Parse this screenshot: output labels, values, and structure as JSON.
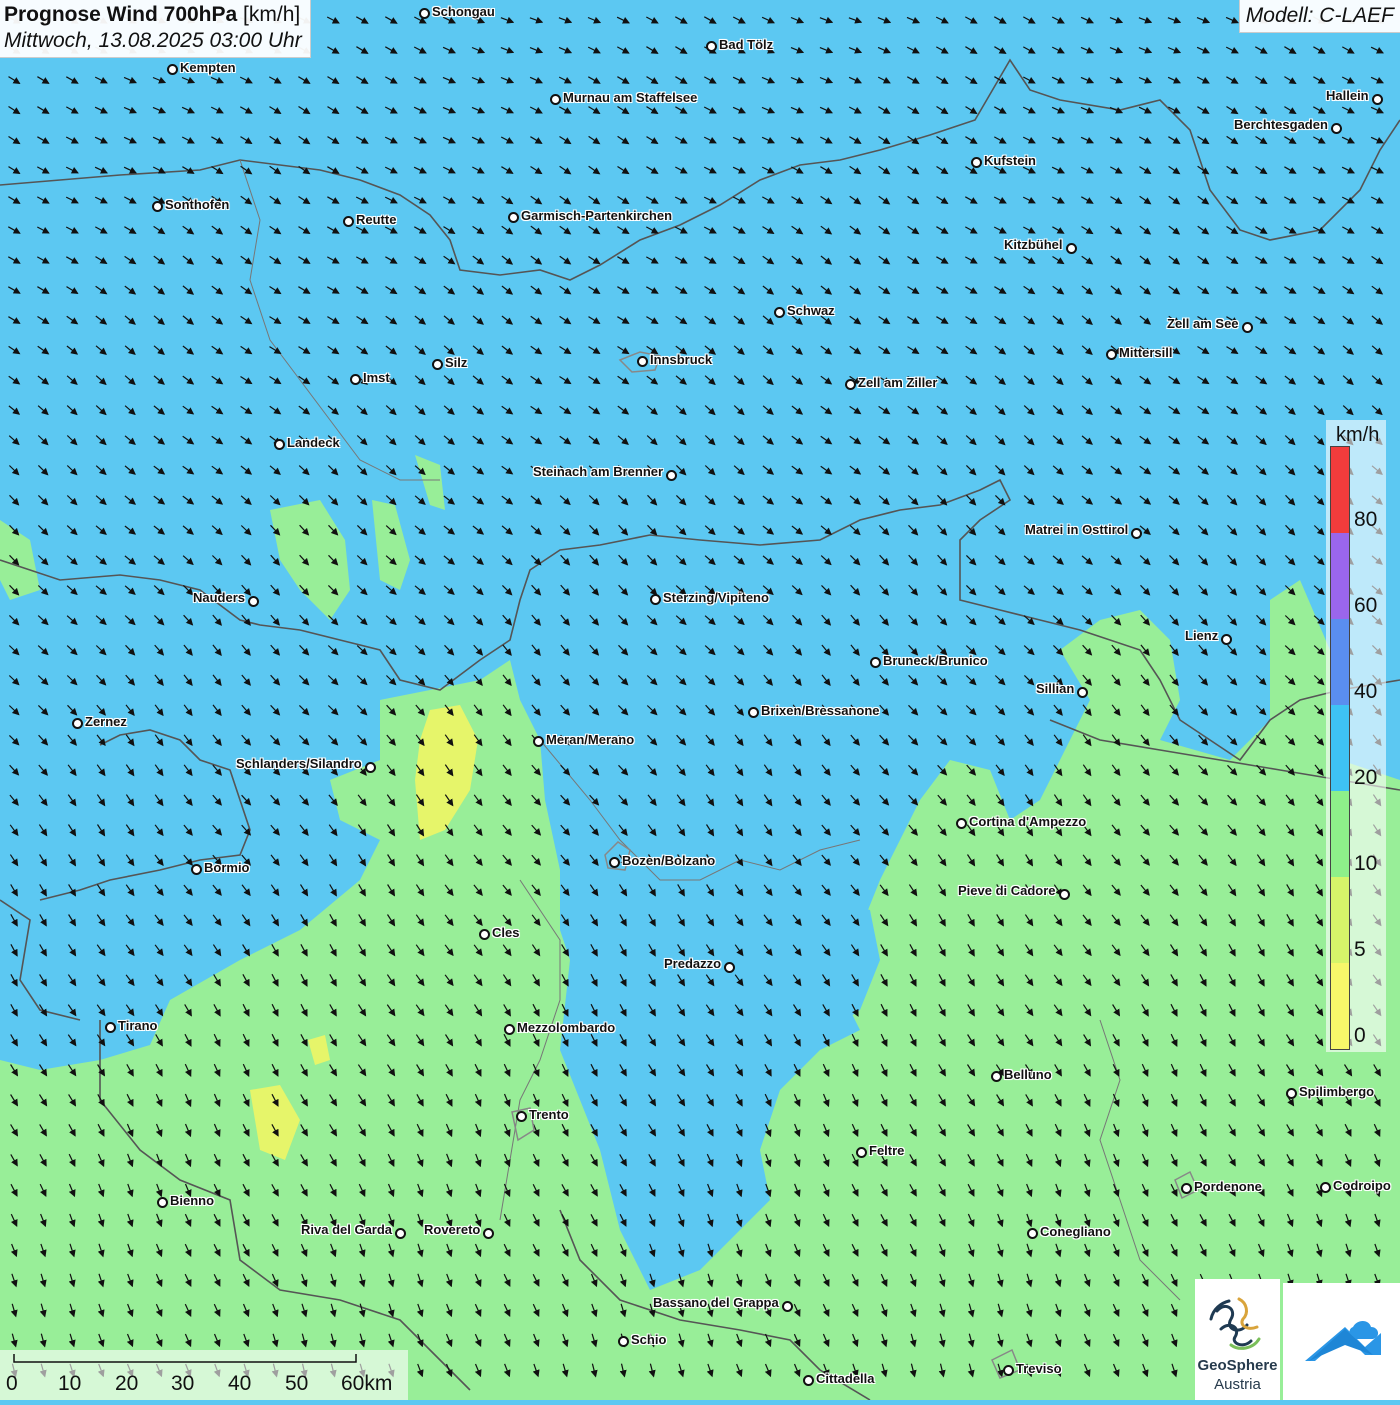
{
  "title": {
    "main_bold": "Prognose Wind 700hPa",
    "main_unit": "[km/h]",
    "subtitle": "Mittwoch, 13.08.2025 03:00 Uhr"
  },
  "model": "Modell: C-LAEF",
  "legend": {
    "unit": "km/h",
    "ticks": [
      "80",
      "60",
      "40",
      "20",
      "10",
      "5",
      "0"
    ],
    "classes": [
      {
        "from": 0,
        "to": 5,
        "color": "#f7f76a"
      },
      {
        "from": 5,
        "to": 10,
        "color": "#d6f56a"
      },
      {
        "from": 10,
        "to": 20,
        "color": "#8ef08a"
      },
      {
        "from": 20,
        "to": 40,
        "color": "#3ec3f5"
      },
      {
        "from": 40,
        "to": 60,
        "color": "#5a8ef0"
      },
      {
        "from": 60,
        "to": 80,
        "color": "#9a66ec"
      },
      {
        "from": 80,
        "to": 100,
        "color": "#f23c3c"
      }
    ]
  },
  "scale_bar": {
    "labels": [
      "0",
      "10",
      "20",
      "30",
      "40",
      "50",
      "60km"
    ]
  },
  "wind_direction": "north-west (arrows point south-east to south)",
  "cities": [
    {
      "name": "Schongau"
    },
    {
      "name": "Bad Tölz"
    },
    {
      "name": "Kempten"
    },
    {
      "name": "Murnau am Staffelsee"
    },
    {
      "name": "Hallein"
    },
    {
      "name": "Berchtesgaden"
    },
    {
      "name": "Kufstein"
    },
    {
      "name": "Sonthofen"
    },
    {
      "name": "Reutte"
    },
    {
      "name": "Garmisch-Partenkirchen"
    },
    {
      "name": "Kitzbühel"
    },
    {
      "name": "Schwaz"
    },
    {
      "name": "Zell am See"
    },
    {
      "name": "Mittersill"
    },
    {
      "name": "Silz"
    },
    {
      "name": "Innsbruck"
    },
    {
      "name": "Imst"
    },
    {
      "name": "Zell am Ziller"
    },
    {
      "name": "Landeck"
    },
    {
      "name": "Steinach am Brenner"
    },
    {
      "name": "Matrei in Osttirol"
    },
    {
      "name": "Nauders"
    },
    {
      "name": "Sterzing/Vipiteno"
    },
    {
      "name": "Lienz"
    },
    {
      "name": "Bruneck/Brunico"
    },
    {
      "name": "Sillian"
    },
    {
      "name": "Zernez"
    },
    {
      "name": "Brixen/Bressanone"
    },
    {
      "name": "Meran/Merano"
    },
    {
      "name": "Schlanders/Silandro"
    },
    {
      "name": "Cortina d'Ampezzo"
    },
    {
      "name": "Bozen/Bolzano"
    },
    {
      "name": "Bormio"
    },
    {
      "name": "Pieve di Cadore"
    },
    {
      "name": "Cles"
    },
    {
      "name": "Predazzo"
    },
    {
      "name": "Tirano"
    },
    {
      "name": "Mezzolombardo"
    },
    {
      "name": "Belluno"
    },
    {
      "name": "Spilimbergo"
    },
    {
      "name": "Trento"
    },
    {
      "name": "Feltre"
    },
    {
      "name": "Pordenone"
    },
    {
      "name": "Codroipo"
    },
    {
      "name": "Bienno"
    },
    {
      "name": "Riva del Garda"
    },
    {
      "name": "Rovereto"
    },
    {
      "name": "Conegliano"
    },
    {
      "name": "Bassano del Grappa"
    },
    {
      "name": "Schio"
    },
    {
      "name": "Treviso"
    },
    {
      "name": "Cittadella"
    }
  ],
  "logo": {
    "line1": "GeoSphere",
    "line2": "Austria"
  },
  "colors": {
    "wind_blue": "#3ec3f5",
    "wind_green": "#8ef08a",
    "wind_yellow": "#e8f56a",
    "border": "#555555"
  }
}
